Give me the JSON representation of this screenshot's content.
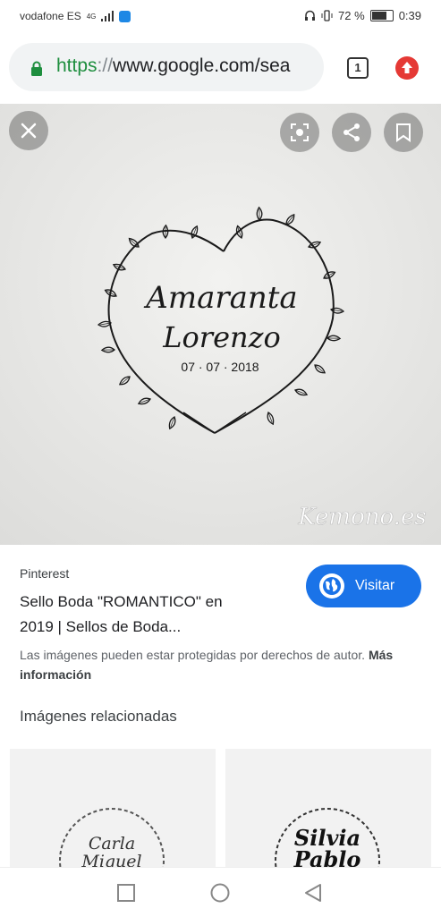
{
  "status_bar": {
    "carrier": "vodafone ES",
    "network": "4G",
    "battery": "72 %",
    "time": "0:39"
  },
  "browser": {
    "url_scheme": "https",
    "url_sep": "://",
    "url_host": "www.google.com/sea",
    "tab_count": "1"
  },
  "image": {
    "name_line1": "Amaranta",
    "name_line2": "Lorenzo",
    "date": "07 · 07 · 2018",
    "watermark": "Kemono.es"
  },
  "result": {
    "source": "Pinterest",
    "title_line1": "Sello Boda \"ROMANTICO\" en",
    "title_line2": "2019 | Sellos de Boda...",
    "visit_label": "Visitar",
    "notice": "Las imágenes pueden estar protegidas por derechos de autor.",
    "notice_link": "Más información"
  },
  "related": {
    "heading": "Imágenes relacionadas",
    "thumb1_line1": "Carla",
    "thumb1_line2": "Miquel",
    "thumb2_line1": "Silvia",
    "thumb2_line2": "Pablo"
  },
  "icons": {
    "close": "close-icon",
    "lens": "lens-icon",
    "share": "share-icon",
    "bookmark": "bookmark-icon",
    "nav_recents": "square-icon",
    "nav_home": "circle-icon",
    "nav_back": "triangle-back-icon"
  },
  "colors": {
    "accent": "#1a73e8",
    "lock": "#1e8e3e",
    "update": "#e53935"
  }
}
